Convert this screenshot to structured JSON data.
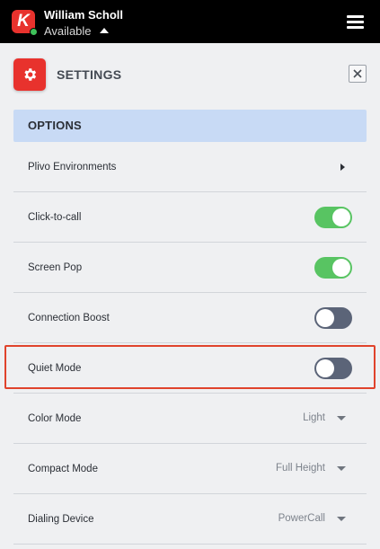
{
  "header": {
    "logo_letter": "K",
    "user_name": "William Scholl",
    "status": "Available",
    "status_color": "#3fc25a",
    "menu_icon": "hamburger-menu-icon"
  },
  "page": {
    "title": "SETTINGS",
    "icon": "gear-icon",
    "close_icon": "close-icon"
  },
  "section": {
    "title": "OPTIONS"
  },
  "rows": [
    {
      "label": "Plivo Environments",
      "control": "submenu"
    },
    {
      "label": "Click-to-call",
      "control": "toggle",
      "on": true
    },
    {
      "label": "Screen Pop",
      "control": "toggle",
      "on": true
    },
    {
      "label": "Connection Boost",
      "control": "toggle",
      "on": false
    },
    {
      "label": "Quiet Mode",
      "control": "toggle",
      "on": false,
      "highlighted": true
    },
    {
      "label": "Color Mode",
      "control": "select",
      "value": "Light"
    },
    {
      "label": "Compact Mode",
      "control": "select",
      "value": "Full Height"
    },
    {
      "label": "Dialing Device",
      "control": "select",
      "value": "PowerCall"
    }
  ],
  "colors": {
    "accent": "#e8322d",
    "toggle_on": "#58c462",
    "toggle_off": "#5b6478",
    "section_bg": "#c8daf5",
    "highlight": "#e0432c"
  }
}
